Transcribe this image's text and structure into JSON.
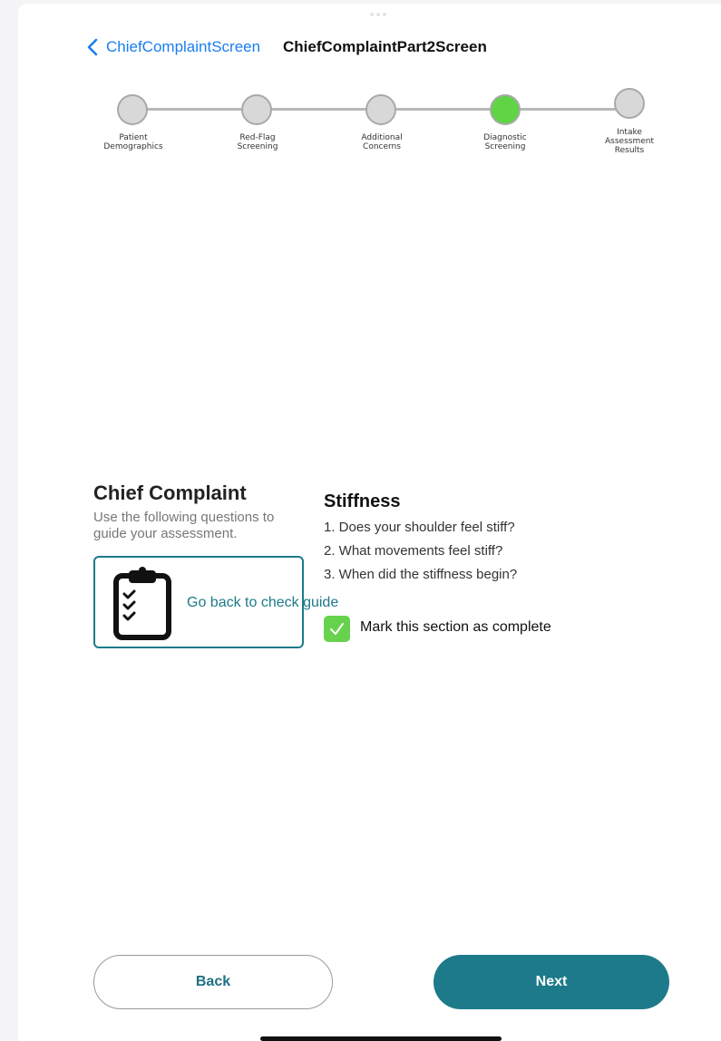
{
  "nav": {
    "back_label": "ChiefComplaintScreen",
    "title": "ChiefComplaintPart2Screen"
  },
  "stepper": {
    "steps": [
      {
        "label": "Patient\nDemographics",
        "state": "incomplete"
      },
      {
        "label": "Red-Flag\nScreening",
        "state": "incomplete"
      },
      {
        "label": "Additional\nConcerns",
        "state": "incomplete"
      },
      {
        "label": "Diagnostic\nScreening",
        "state": "current"
      },
      {
        "label": "Intake\nAssessment\nResults",
        "state": "incomplete"
      }
    ],
    "active_color": "#5fd444",
    "inactive_color": "#d8d8d8"
  },
  "chief_complaint": {
    "title": "Chief Complaint",
    "subtitle": "Use the following questions to guide your assessment.",
    "guide_link": "Go back to check guide",
    "guide_icon": "clipboard-checklist-icon"
  },
  "section": {
    "title": "Stiffness",
    "questions": [
      "1. Does your shoulder feel stiff?",
      "2. What movements feel stiff?",
      "3. When did the stiffness begin?"
    ],
    "complete_label": "Mark this section as complete",
    "complete_checked": true
  },
  "footer": {
    "back_label": "Back",
    "next_label": "Next"
  },
  "colors": {
    "accent": "#1d7a8a",
    "link": "#1a7df0",
    "check": "#66d24e"
  }
}
